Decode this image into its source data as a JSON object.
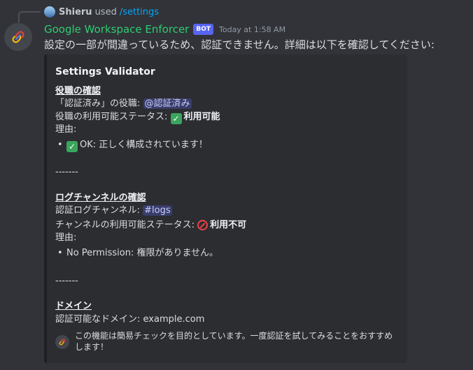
{
  "reply": {
    "username": "Shieru",
    "used_text": "used",
    "command": "/settings"
  },
  "message": {
    "bot_name": "Google Workspace Enforcer",
    "bot_tag": "BOT",
    "timestamp": "Today at 1:58 AM",
    "content": "設定の一部が間違っているため、認証できません。詳細は以下を確認してください:"
  },
  "embed": {
    "title": "Settings Validator",
    "role_section": {
      "heading": "役職の確認",
      "role_label": "「認証済み」の役職: ",
      "role_mention": "@認証済み",
      "status_label": "役職の利用可能ステータス: ",
      "status_icon": "check-icon",
      "status_value": "利用可能",
      "reason_label": "理由:",
      "reason_item": "OK: 正しく構成されています！"
    },
    "separator1": "-------",
    "channel_section": {
      "heading": "ログチャンネルの確認",
      "channel_label": "認証ログチャンネル: ",
      "channel_mention": "#logs",
      "status_label": "チャンネルの利用可能ステータス: ",
      "status_icon": "no-entry-icon",
      "status_value": "利用不可",
      "reason_label": "理由:",
      "reason_item": "No Permission: 権限がありません。"
    },
    "separator2": "-------",
    "domain_section": {
      "heading": "ドメイン",
      "domain_label": "認証可能なドメイン: ",
      "domain_value": "example.com"
    },
    "footer_text": "この機能は簡易チェックを目的としています。一度認証を試してみることをおすすめします！"
  },
  "colors": {
    "background": "#313338",
    "embed_background": "#2b2d31",
    "bot_name": "#2ecc71",
    "bot_tag": "#5865f2",
    "command": "#00a8fc",
    "check": "#3ba55d",
    "no_entry": "#ed4245"
  }
}
